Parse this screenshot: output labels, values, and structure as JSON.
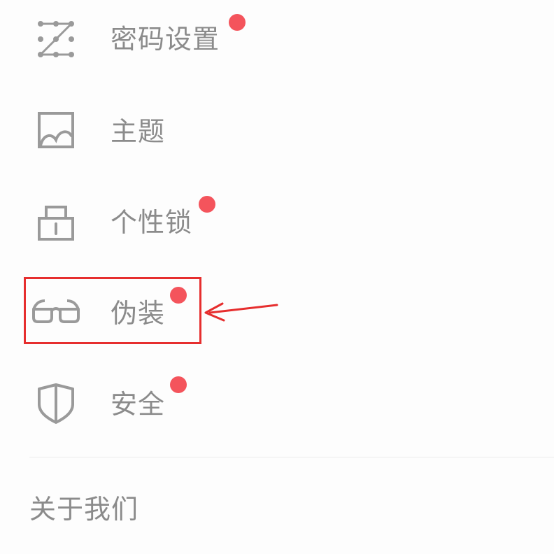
{
  "menu": {
    "items": [
      {
        "label": "密码设置",
        "icon": "pattern-grid-icon",
        "badge": true
      },
      {
        "label": "主题",
        "icon": "theme-picture-icon",
        "badge": false
      },
      {
        "label": "个性锁",
        "icon": "padlock-icon",
        "badge": true
      },
      {
        "label": "伪装",
        "icon": "glasses-icon",
        "badge": true
      },
      {
        "label": "安全",
        "icon": "shield-icon",
        "badge": true
      }
    ],
    "about_label": "关于我们"
  },
  "annotation": {
    "highlighted_item": "伪装"
  },
  "colors": {
    "text": "#8b8b8b",
    "icon": "#9a9a9a",
    "badge": "#f4545c",
    "highlight": "#e62e2e",
    "divider": "#ececec"
  }
}
